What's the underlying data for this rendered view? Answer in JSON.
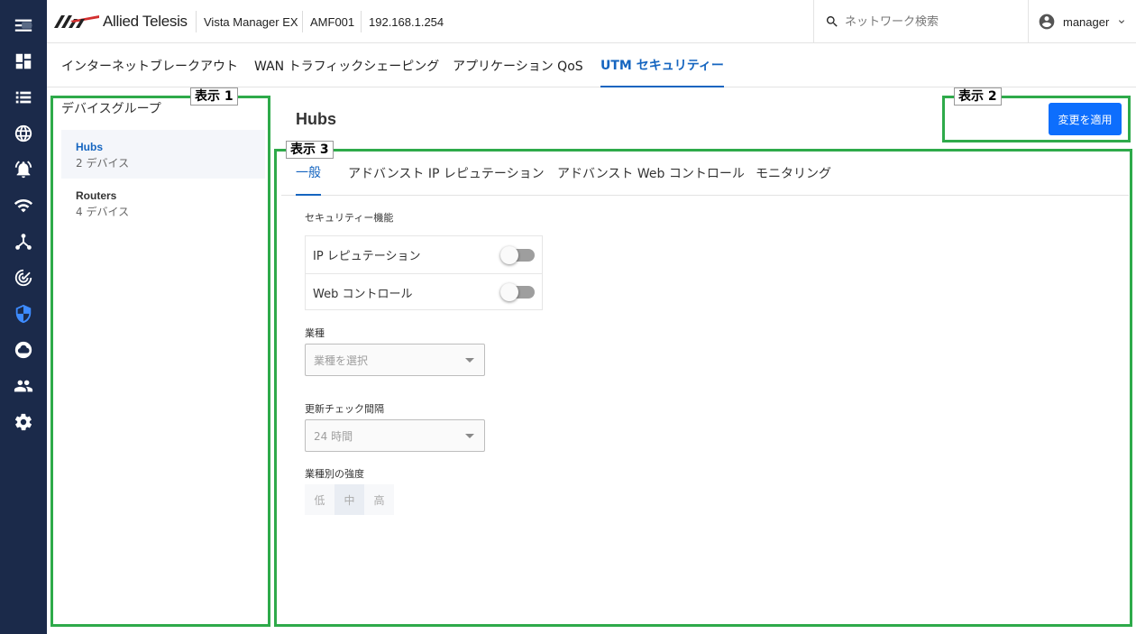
{
  "header": {
    "logo_text": "Allied Telesis",
    "product": "Vista Manager EX",
    "device": "AMF001",
    "ip": "192.168.1.254",
    "search_placeholder": "ネットワーク検索",
    "user": "manager"
  },
  "rail_icons": [
    "menu-icon",
    "dashboard-icon",
    "list-icon",
    "globe-icon",
    "alarm-icon",
    "wifi-icon",
    "topology-icon",
    "radar-icon",
    "shield-icon",
    "cloud-icon",
    "people-icon",
    "gear-icon"
  ],
  "top_tabs": [
    {
      "label": "インターネットブレークアウト"
    },
    {
      "label": "WAN トラフィックシェーピング"
    },
    {
      "label": "アプリケーション QoS"
    },
    {
      "label": "UTM セキュリティー",
      "active": true
    }
  ],
  "groups": {
    "title": "デバイスグループ",
    "items": [
      {
        "name": "Hubs",
        "sub": "2 デバイス",
        "active": true
      },
      {
        "name": "Routers",
        "sub": "4 デバイス"
      }
    ]
  },
  "main": {
    "title": "Hubs",
    "apply_label": "変更を適用",
    "tabs": [
      {
        "label": "一般",
        "active": true
      },
      {
        "label": "アドバンスト IP レピュテーション"
      },
      {
        "label": "アドバンスト Web コントロール"
      },
      {
        "label": "モニタリング"
      }
    ],
    "security_label": "セキュリティー機能",
    "toggles": [
      {
        "label": "IP レピュテーション",
        "on": false
      },
      {
        "label": "Web コントロール",
        "on": false
      }
    ],
    "industry_label": "業種",
    "industry_placeholder": "業種を選択",
    "interval_label": "更新チェック間隔",
    "interval_value": "24 時間",
    "strength_label": "業種別の強度",
    "strength_options": [
      "低",
      "中",
      "高"
    ],
    "strength_selected": "中"
  },
  "annotations": [
    "表示 1",
    "表示 2",
    "表示 3"
  ],
  "colors": {
    "rail": "#1b2a4a",
    "accent": "#1565c0",
    "button": "#0d6efd",
    "annotation": "#2eaa4a"
  }
}
